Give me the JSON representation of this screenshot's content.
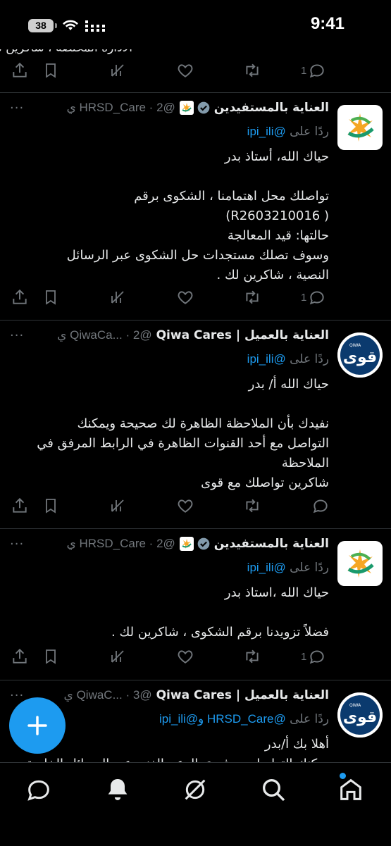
{
  "status_bar": {
    "time": "9:41",
    "battery": "38"
  },
  "fragment": {
    "text": "الأدارة المختصة ، شاكرين تواصلك .",
    "reply_count": "1"
  },
  "tweets": [
    {
      "name": "العناية بالمستفيدين",
      "handle": "@HRSD_Care · 2 ي",
      "reply_prefix": "ردًا على",
      "reply_handles": "@ipi_ili",
      "lines": [
        "حياك الله، أستاذ بدر",
        "",
        "تواصلك محل اهتمامنا ، الشكوى برقم",
        "( R2603210016)",
        "حالتها: قيد المعالجة",
        "وسوف تصلك مستجدات حل الشكوى عبر الرسائل",
        "النصية ، شاكرين لك ."
      ],
      "reply_count": "1"
    },
    {
      "name": "العناية بالعميل | Qiwa Cares",
      "handle": "@QiwaCa... · 2 ي",
      "reply_prefix": "ردًا على",
      "reply_handles": "@ipi_ili",
      "lines": [
        "حياك الله أ/ بدر",
        "",
        "نفيدك بأن الملاحظة الظاهرة لك صحيحة ويمكنك",
        "التواصل مع أحد القنوات الظاهرة في الرابط المرفق في",
        "الملاحظة",
        "شاكرين تواصلك مع قوى"
      ],
      "reply_count": ""
    },
    {
      "name": "العناية بالمستفيدين",
      "handle": "@HRSD_Care · 2 ي",
      "reply_prefix": "ردًا على",
      "reply_handles": "@ipi_ili",
      "lines": [
        "حياك الله ،استاذ بدر",
        "",
        "فضلاً تزويدنا برقم الشكوى ، شاكرين لك ."
      ],
      "reply_count": "1"
    },
    {
      "name": "العناية بالعميل | Qiwa Cares",
      "handle": "@QiwaC... · 3 ي",
      "reply_prefix": "ردًا على",
      "reply_handles": "@HRSD_Care و@ipi_ili",
      "lines": [
        "أهلا بك أ/بدر",
        "يمكنك التواصل مع فريق الدعم الفني عبر الرسائل الخاصة لمتابعة"
      ],
      "reply_count": ""
    }
  ],
  "avatar_text": {
    "qiwa_small": "QIWA",
    "qiwa_big": "قوى"
  },
  "colors": {
    "accent": "#1d9bf0",
    "muted": "#71767b",
    "background": "#000000"
  },
  "icons": {
    "actions": [
      "share-icon",
      "bookmark-icon",
      "views-icon",
      "like-icon",
      "retweet-icon",
      "reply-icon"
    ],
    "tabs": [
      "messages-icon",
      "notifications-icon",
      "communities-icon",
      "search-icon",
      "home-icon"
    ],
    "fab": "plus-icon"
  }
}
